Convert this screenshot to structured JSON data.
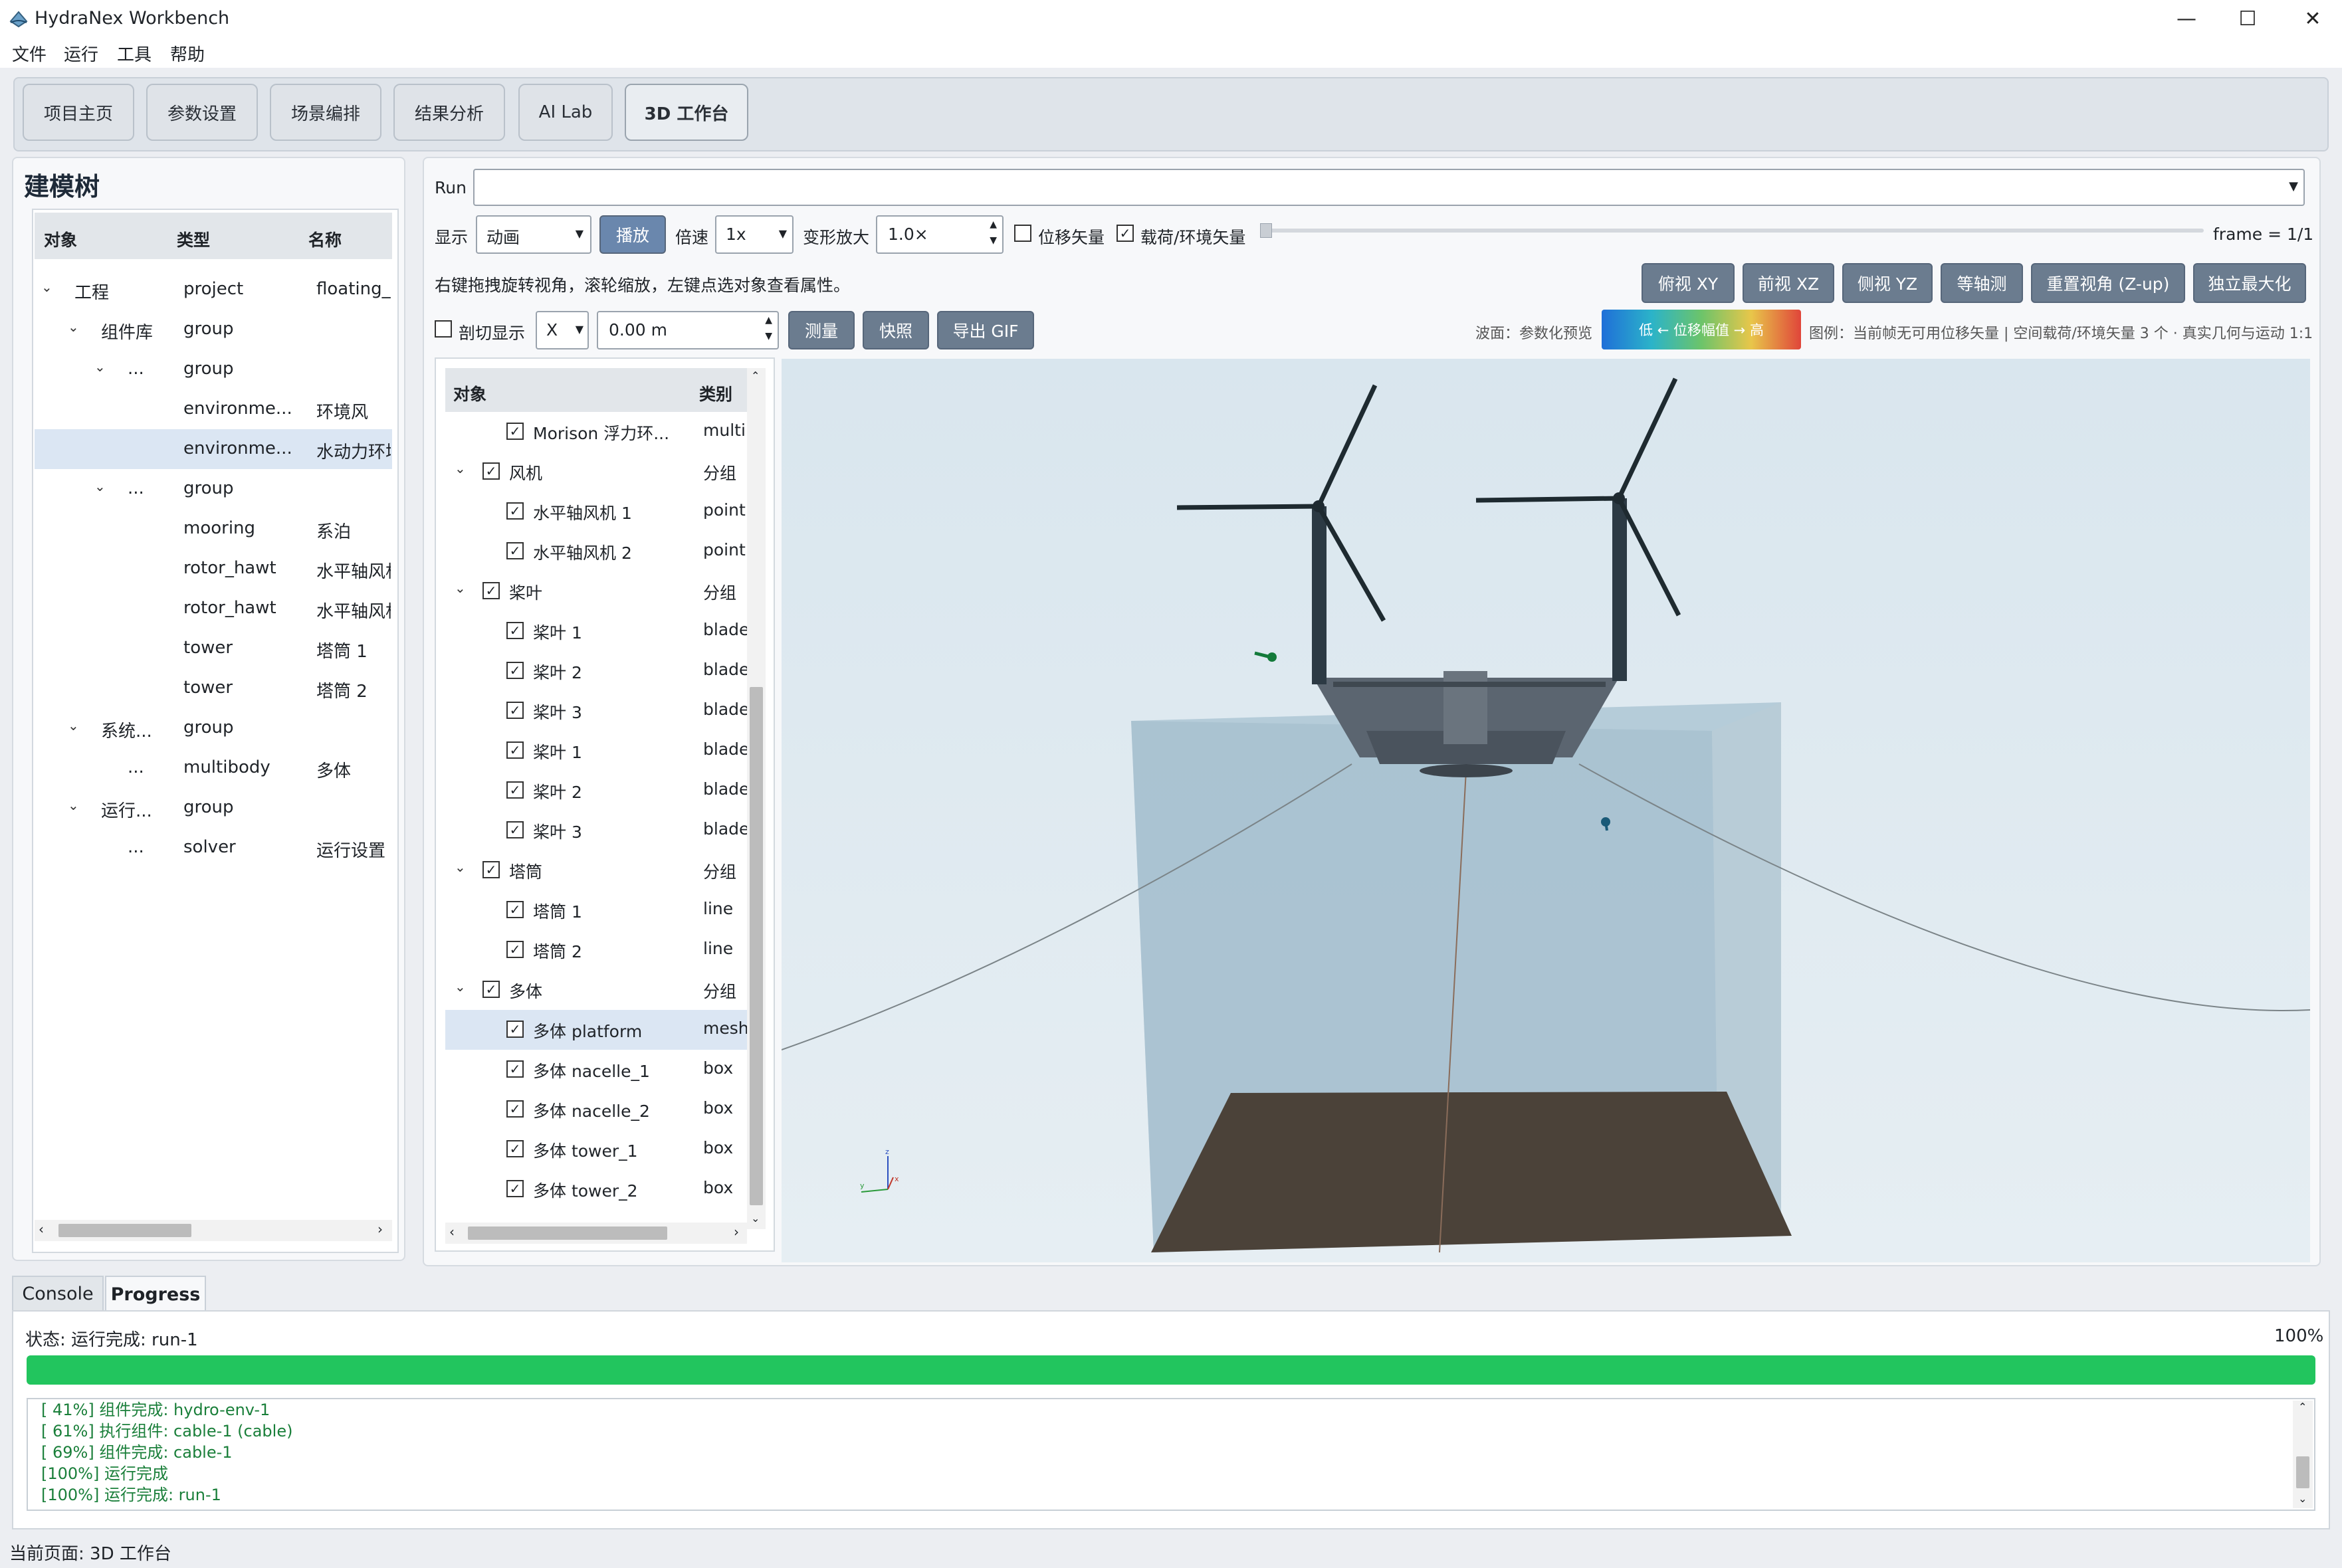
{
  "window": {
    "title": "HydraNex Workbench"
  },
  "menu": [
    "文件",
    "运行",
    "工具",
    "帮助"
  ],
  "nav_tabs": [
    "项目主页",
    "参数设置",
    "场景编排",
    "结果分析",
    "AI Lab",
    "3D 工作台"
  ],
  "active_tab": "3D 工作台",
  "left_panel": {
    "title": "建模树",
    "columns": [
      "对象",
      "类型",
      "名称"
    ],
    "rows": [
      {
        "obj": "工程",
        "type": "project",
        "name": "floating_m",
        "level": 0,
        "expander": "open"
      },
      {
        "obj": "组件库",
        "type": "group",
        "name": "",
        "level": 1,
        "expander": "open"
      },
      {
        "obj": "...",
        "type": "group",
        "name": "",
        "level": 2,
        "expander": "open"
      },
      {
        "obj": "",
        "type": "environme...",
        "name": "环境风",
        "level": 3
      },
      {
        "obj": "",
        "type": "environme...",
        "name": "水动力环境",
        "level": 3,
        "selected": true
      },
      {
        "obj": "...",
        "type": "group",
        "name": "",
        "level": 2,
        "expander": "open"
      },
      {
        "obj": "",
        "type": "mooring",
        "name": "系泊",
        "level": 3
      },
      {
        "obj": "",
        "type": "rotor_hawt",
        "name": "水平轴风机",
        "level": 3
      },
      {
        "obj": "",
        "type": "rotor_hawt",
        "name": "水平轴风机",
        "level": 3
      },
      {
        "obj": "",
        "type": "tower",
        "name": "塔筒 1",
        "level": 3
      },
      {
        "obj": "",
        "type": "tower",
        "name": "塔筒 2",
        "level": 3
      },
      {
        "obj": "系统...",
        "type": "group",
        "name": "",
        "level": 1,
        "expander": "open"
      },
      {
        "obj": "...",
        "type": "multibody",
        "name": "多体",
        "level": 2
      },
      {
        "obj": "运行...",
        "type": "group",
        "name": "",
        "level": 1,
        "expander": "open"
      },
      {
        "obj": "...",
        "type": "solver",
        "name": "运行设置",
        "level": 2
      }
    ]
  },
  "controls": {
    "run_label": "Run",
    "run_value": "",
    "display_label": "显示",
    "display_value": "动画",
    "play_button": "播放",
    "speed_label": "倍速",
    "speed_value": "1x",
    "deform_label": "变形放大",
    "deform_value": "1.0×",
    "disp_vector_label": "位移矢量",
    "disp_vector_checked": false,
    "load_vector_label": "载荷/环境矢量",
    "load_vector_checked": true,
    "frame_label": "frame = 1/1",
    "hint": "右键拖拽旋转视角，滚轮缩放，左键点选对象查看属性。",
    "view_buttons": [
      "俯视 XY",
      "前视 XZ",
      "侧视 YZ",
      "等轴测",
      "重置视角 (Z-up)",
      "独立最大化"
    ],
    "clip_label": "剖切显示",
    "clip_checked": false,
    "clip_axis": "X",
    "clip_offset": "0.00 m",
    "tool_buttons": [
      "测量",
      "快照",
      "导出 GIF"
    ],
    "wave_label": "波面：参数化预览",
    "colorbar_text": "低 ← 位移幅值 → 高",
    "legend_text": "图例：当前帧无可用位移矢量 | 空间载荷/环境矢量 3 个 · 真实几何与运动 1:1"
  },
  "object_list": {
    "columns": [
      "对象",
      "类别"
    ],
    "rows": [
      {
        "name": "Morison 浮力环...",
        "cat": "multi",
        "level": 1,
        "checked": true
      },
      {
        "name": "风机",
        "cat": "分组",
        "level": 0,
        "checked": true,
        "expander": "open"
      },
      {
        "name": "水平轴风机 1",
        "cat": "point",
        "level": 1,
        "checked": true
      },
      {
        "name": "水平轴风机 2",
        "cat": "point",
        "level": 1,
        "checked": true
      },
      {
        "name": "桨叶",
        "cat": "分组",
        "level": 0,
        "checked": true,
        "expander": "open"
      },
      {
        "name": "桨叶 1",
        "cat": "blade",
        "level": 1,
        "checked": true
      },
      {
        "name": "桨叶 2",
        "cat": "blade",
        "level": 1,
        "checked": true
      },
      {
        "name": "桨叶 3",
        "cat": "blade",
        "level": 1,
        "checked": true
      },
      {
        "name": "桨叶 1",
        "cat": "blade",
        "level": 1,
        "checked": true
      },
      {
        "name": "桨叶 2",
        "cat": "blade",
        "level": 1,
        "checked": true
      },
      {
        "name": "桨叶 3",
        "cat": "blade",
        "level": 1,
        "checked": true
      },
      {
        "name": "塔筒",
        "cat": "分组",
        "level": 0,
        "checked": true,
        "expander": "open"
      },
      {
        "name": "塔筒 1",
        "cat": "line",
        "level": 1,
        "checked": true
      },
      {
        "name": "塔筒 2",
        "cat": "line",
        "level": 1,
        "checked": true
      },
      {
        "name": "多体",
        "cat": "分组",
        "level": 0,
        "checked": true,
        "expander": "open"
      },
      {
        "name": "多体 platform",
        "cat": "mesh",
        "level": 1,
        "checked": true,
        "selected": true
      },
      {
        "name": "多体 nacelle_1",
        "cat": "box",
        "level": 1,
        "checked": true
      },
      {
        "name": "多体 nacelle_2",
        "cat": "box",
        "level": 1,
        "checked": true
      },
      {
        "name": "多体 tower_1",
        "cat": "box",
        "level": 1,
        "checked": true
      },
      {
        "name": "多体 tower_2",
        "cat": "box",
        "level": 1,
        "checked": true
      }
    ]
  },
  "axis_labels": {
    "z": "z",
    "y": "y",
    "x": "x"
  },
  "console": {
    "tabs": [
      "Console",
      "Progress"
    ],
    "active_tab": "Progress",
    "status_text": "状态: 运行完成: run-1",
    "percent_text": "100%",
    "progress": 1.0,
    "log": [
      "[ 41%] 组件完成: hydro-env-1",
      "[ 61%] 执行组件: cable-1 (cable)",
      "[ 69%] 组件完成: cable-1",
      "[100%] 运行完成",
      "[100%] 运行完成: run-1"
    ]
  },
  "statusbar": "当前页面: 3D 工作台",
  "colors": {
    "accent": "#22c55e",
    "button": "#6b7c8f",
    "selection": "#dbe6f3",
    "water": "#a9c3d3",
    "seabed": "#4a4238"
  }
}
